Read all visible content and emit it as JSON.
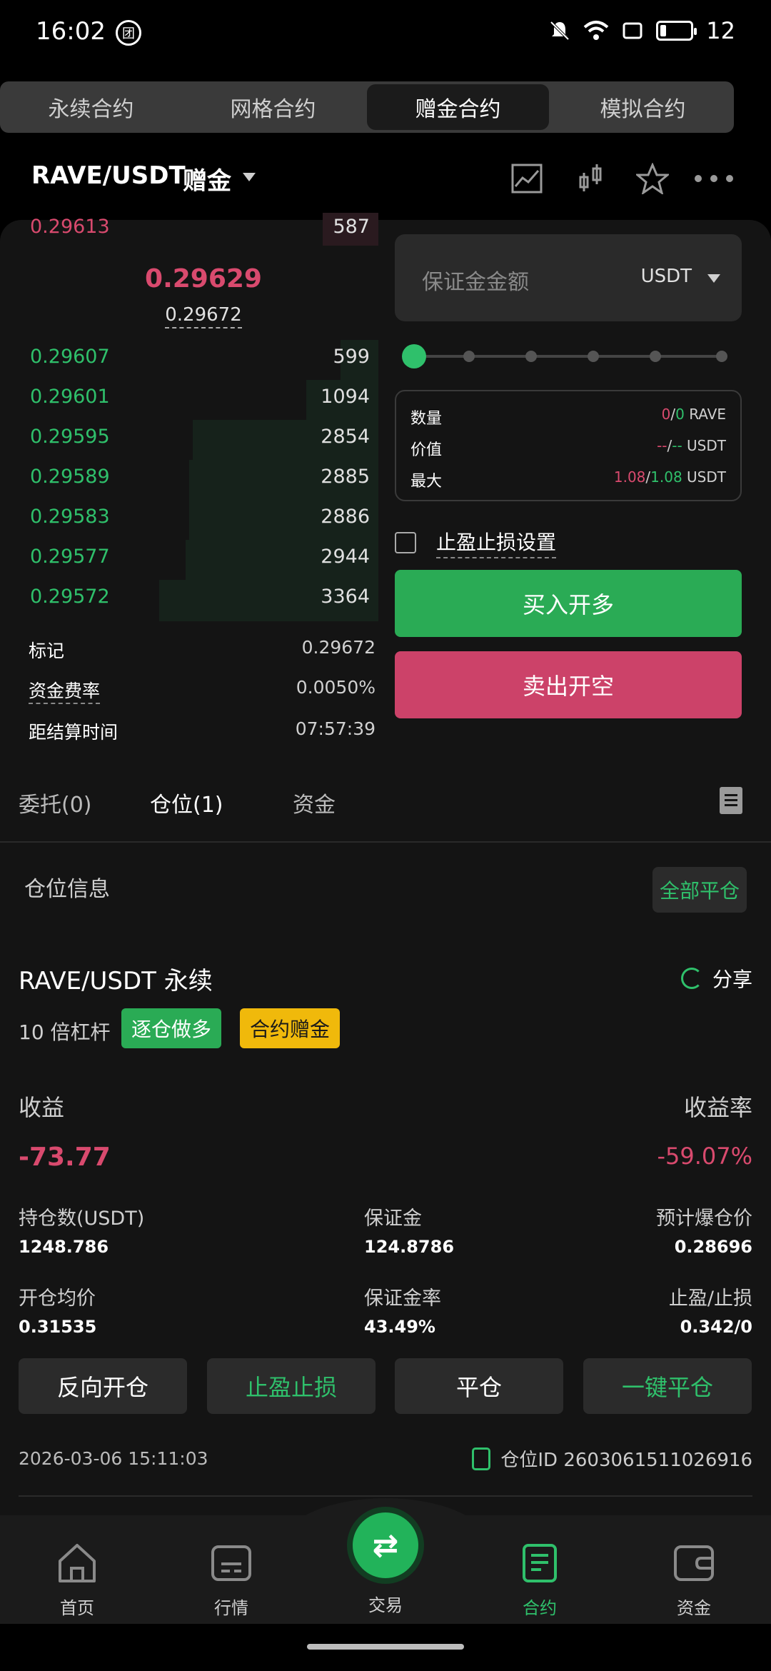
{
  "status": {
    "time": "16:02",
    "app_icon_glyph": "团",
    "battery_level": "12"
  },
  "contract_tabs": [
    "永续合约",
    "网格合约",
    "赠金合约",
    "模拟合约"
  ],
  "header": {
    "pair": "RAVE/USDT",
    "type": "赠金"
  },
  "orderbook": {
    "ask_top": {
      "price": "0.29613",
      "qty": "587"
    },
    "last_price": "0.29629",
    "mark_price": "0.29672",
    "bids": [
      {
        "price": "0.29607",
        "qty": "599",
        "depth": 0.1
      },
      {
        "price": "0.29601",
        "qty": "1094",
        "depth": 0.19
      },
      {
        "price": "0.29595",
        "qty": "2854",
        "depth": 0.49
      },
      {
        "price": "0.29589",
        "qty": "2885",
        "depth": 0.5
      },
      {
        "price": "0.29583",
        "qty": "2886",
        "depth": 0.5
      },
      {
        "price": "0.29577",
        "qty": "2944",
        "depth": 0.51
      },
      {
        "price": "0.29572",
        "qty": "3364",
        "depth": 0.58
      }
    ]
  },
  "market_info": [
    {
      "label": "标记",
      "value": "0.29672"
    },
    {
      "label": "资金费率",
      "value": "0.0050%"
    },
    {
      "label": "距结算时间",
      "value": "07:57:39"
    }
  ],
  "order_form": {
    "margin_placeholder": "保证金金额",
    "unit": "USDT",
    "stats": [
      {
        "label": "数量",
        "a": "0",
        "b": "0",
        "unit": "RAVE"
      },
      {
        "label": "价值",
        "a": "--",
        "b": "--",
        "unit": "USDT"
      },
      {
        "label": "最大",
        "a": "1.08",
        "b": "1.08",
        "unit": "USDT"
      }
    ],
    "tpsl_label": "止盈止损设置",
    "buy_label": "买入开多",
    "sell_label": "卖出开空"
  },
  "position_tabs": [
    "委托(0)",
    "仓位(1)",
    "资金"
  ],
  "position": {
    "title": "仓位信息",
    "close_all": "全部平仓",
    "symbol": "RAVE/USDT 永续",
    "share": "分享",
    "leverage": "10 倍杠杆",
    "tag_mode": "逐仓做多",
    "tag_bonus": "合约赠金",
    "pnl_label": "收益",
    "pnl_rate_label": "收益率",
    "pnl": "-73.77",
    "pnl_rate": "-59.07%",
    "fields": [
      {
        "label": "持仓数(USDT)",
        "value": "1248.786"
      },
      {
        "label": "保证金",
        "value": "124.8786"
      },
      {
        "label": "预计爆仓价",
        "value": "0.28696"
      },
      {
        "label": "开仓均价",
        "value": "0.31535"
      },
      {
        "label": "保证金率",
        "value": "43.49%"
      },
      {
        "label": "止盈/止损",
        "value": "0.342/0"
      }
    ],
    "actions": [
      "反向开仓",
      "止盈止损",
      "平仓",
      "一键平仓"
    ],
    "timestamp": "2026-03-06 15:11:03",
    "position_id": "仓位ID 2603061511026916"
  },
  "nav": [
    "首页",
    "行情",
    "交易",
    "合约",
    "资金"
  ],
  "colors": {
    "green": "#2fc06b",
    "red": "#d94a6e",
    "yellow": "#f0b90b"
  }
}
